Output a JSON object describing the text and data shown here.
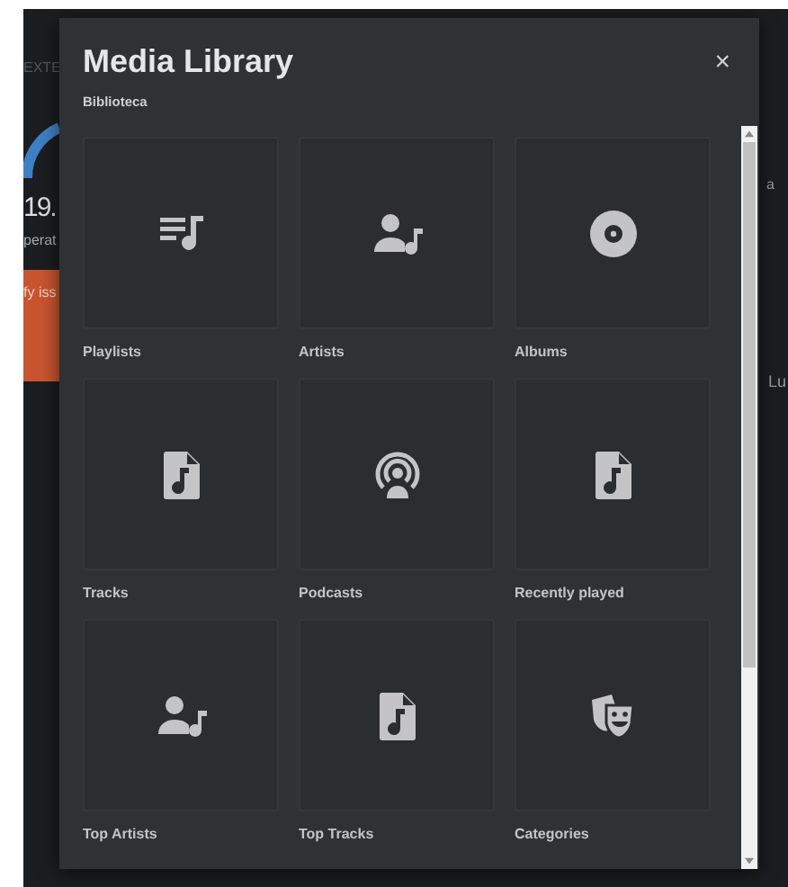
{
  "background": {
    "texts": [
      {
        "kind": "faint",
        "text": "EXTE"
      },
      {
        "kind": "big",
        "text": "19."
      },
      {
        "kind": "small",
        "text": "perat"
      },
      {
        "kind": "button",
        "text": "fy iss"
      },
      {
        "kind": "right-top",
        "text": "a"
      },
      {
        "kind": "right-bottom",
        "text": "Lu"
      }
    ]
  },
  "dialog": {
    "title": "Media Library",
    "subtitle": "Biblioteca",
    "close": "×",
    "items": [
      {
        "label": "Playlists",
        "kind": "playlist"
      },
      {
        "label": "Artists",
        "kind": "artist"
      },
      {
        "label": "Albums",
        "kind": "album"
      },
      {
        "label": "Tracks",
        "kind": "track"
      },
      {
        "label": "Podcasts",
        "kind": "podcast"
      },
      {
        "label": "Recently played",
        "kind": "track"
      },
      {
        "label": "Top Artists",
        "kind": "artist"
      },
      {
        "label": "Top Tracks",
        "kind": "track"
      },
      {
        "label": "Categories",
        "kind": "category"
      }
    ]
  }
}
